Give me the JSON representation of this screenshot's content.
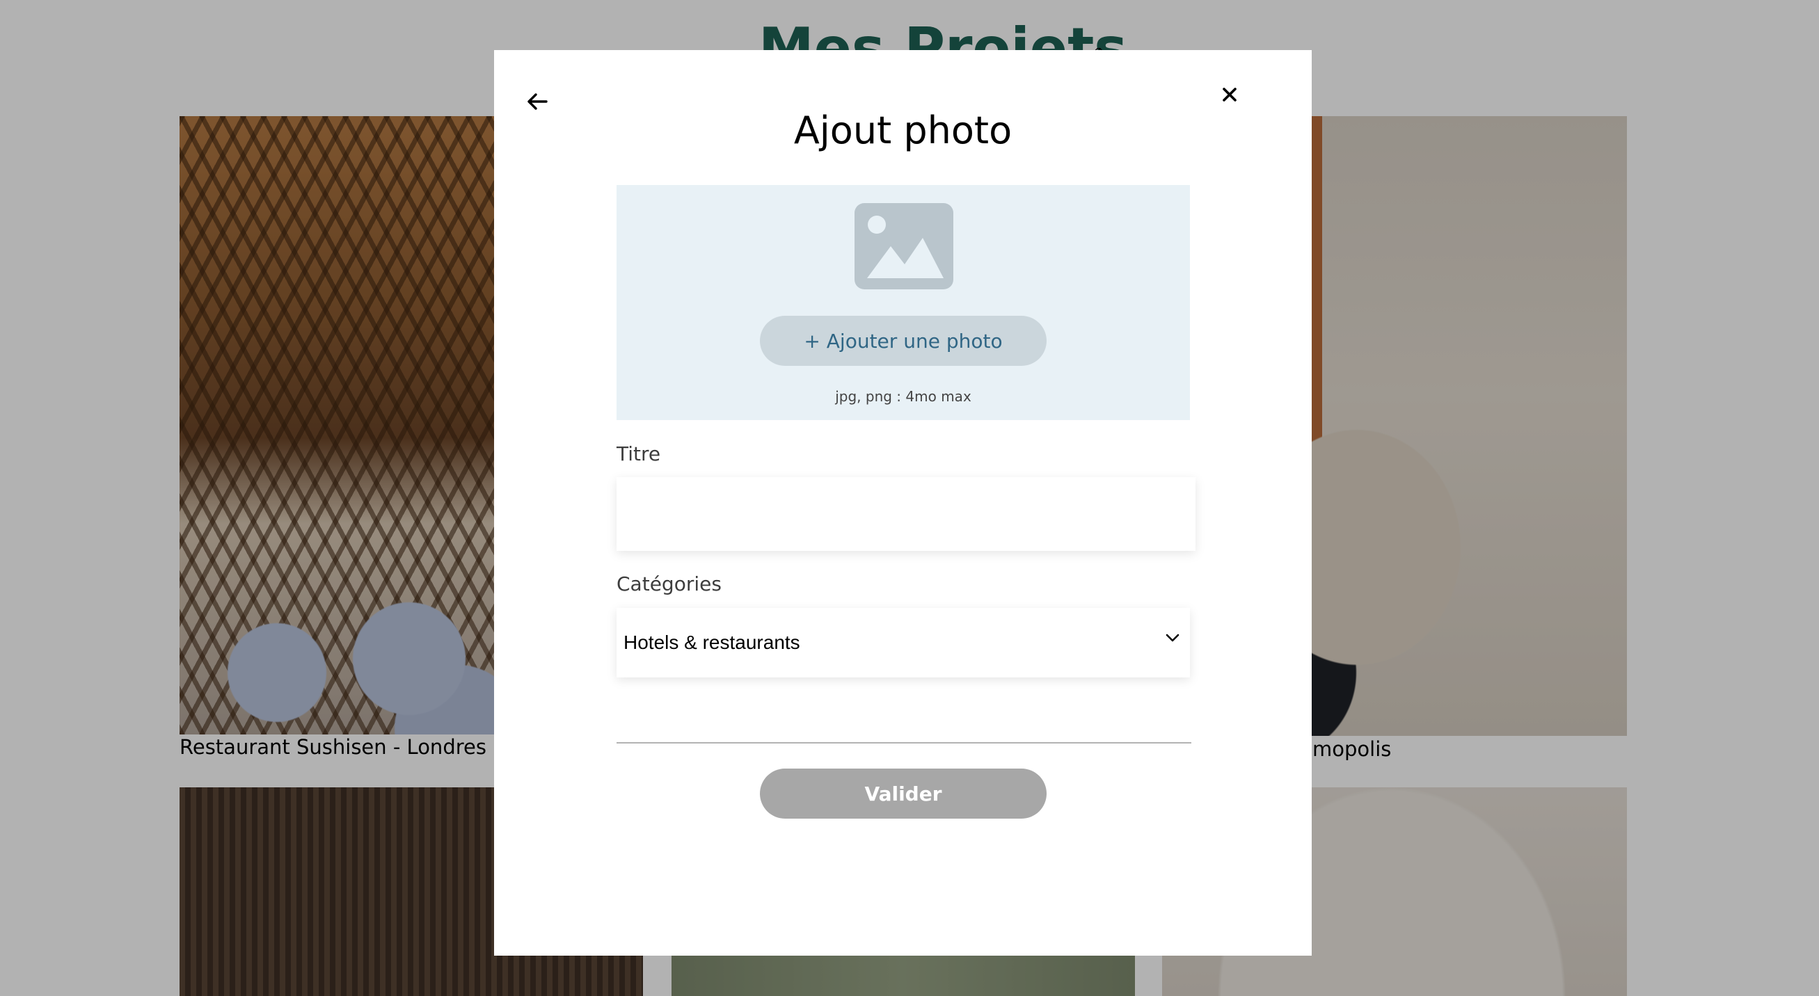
{
  "page": {
    "heading": "Mes Projets",
    "edit_icon": "pencil-icon",
    "projects": [
      {
        "caption": "Restaurant Sushisen - Londres"
      },
      {
        "caption": "mopolis"
      }
    ]
  },
  "modal": {
    "back_icon": "arrow-left-icon",
    "close_icon": "close-icon",
    "title": "Ajout photo",
    "upload": {
      "icon": "image-placeholder-icon",
      "button_label": "+ Ajouter une photo",
      "hint": "jpg, png : 4mo max"
    },
    "form": {
      "title_label": "Titre",
      "title_value": "",
      "categories_label": "Catégories",
      "category_selected": "Hotels & restaurants"
    },
    "submit_label": "Valider"
  },
  "colors": {
    "overlay": "rgba(0,0,0,0.30)",
    "heading_green": "#1D6154",
    "upload_zone_bg": "#E8F1F6",
    "upload_button_bg": "#CBD6DC",
    "upload_button_text": "#306685",
    "submit_disabled": "#A7A7A7"
  }
}
